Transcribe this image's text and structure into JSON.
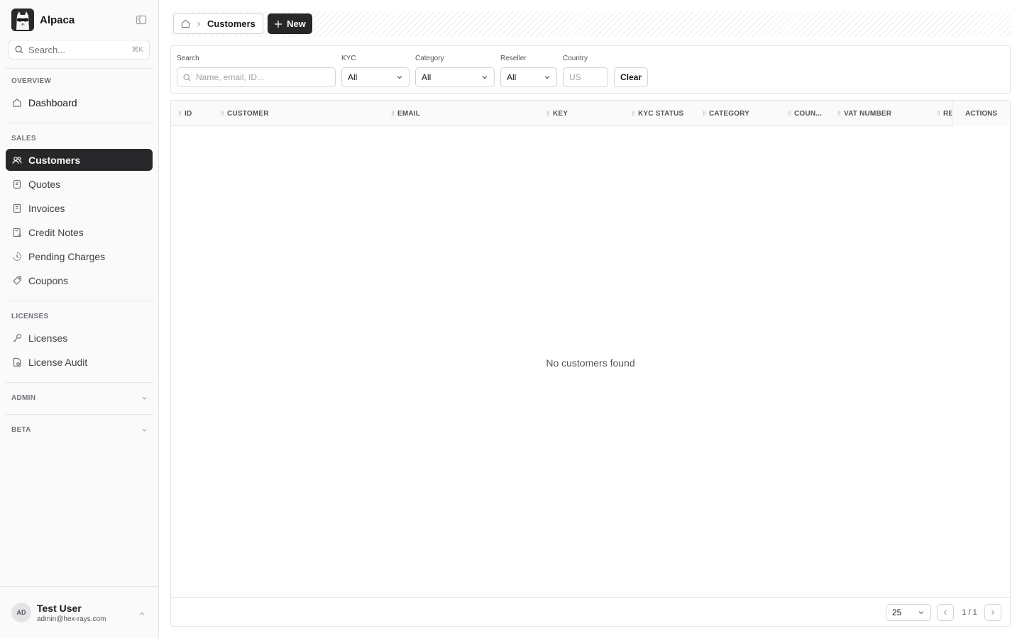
{
  "app": {
    "name": "Alpaca"
  },
  "sidebar": {
    "search": {
      "placeholder": "Search...",
      "shortcut": "⌘K"
    },
    "sections": {
      "overview": "OVERVIEW",
      "sales": "SALES",
      "licenses": "LICENSES",
      "admin": "ADMIN",
      "beta": "BETA"
    },
    "items": {
      "dashboard": "Dashboard",
      "customers": "Customers",
      "quotes": "Quotes",
      "invoices": "Invoices",
      "credit_notes": "Credit Notes",
      "pending_charges": "Pending Charges",
      "coupons": "Coupons",
      "licenses": "Licenses",
      "license_audit": "License Audit"
    },
    "active_item": "customers",
    "user": {
      "initials": "AD",
      "name": "Test User",
      "email": "admin@hex-rays.com"
    }
  },
  "header": {
    "breadcrumb_current": "Customers",
    "new_button": "New"
  },
  "filters": {
    "search": {
      "label": "Search",
      "placeholder": "Name, email, ID..."
    },
    "kyc": {
      "label": "KYC",
      "value": "All"
    },
    "category": {
      "label": "Category",
      "value": "All"
    },
    "reseller": {
      "label": "Reseller",
      "value": "All"
    },
    "country": {
      "label": "Country",
      "placeholder": "US"
    },
    "clear_button": "Clear"
  },
  "table": {
    "columns": {
      "id": "ID",
      "customer": "CUSTOMER",
      "email": "EMAIL",
      "key": "KEY",
      "kyc_status": "KYC STATUS",
      "category": "CATEGORY",
      "country": "COUN...",
      "vat_number": "VAT NUMBER",
      "reseller": "RE",
      "actions": "ACTIONS"
    },
    "empty_message": "No customers found",
    "page_size": "25",
    "page_indicator": "1 / 1"
  },
  "colors": {
    "active_bg": "#27272a",
    "sidebar_bg": "#fafafa",
    "border": "#e4e4e7"
  }
}
